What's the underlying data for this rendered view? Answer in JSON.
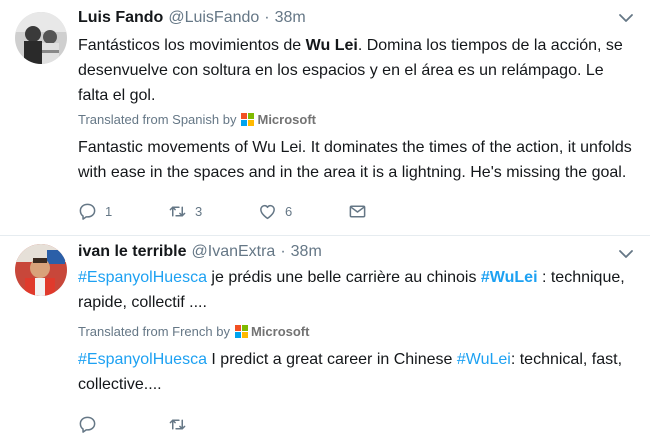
{
  "tweets": [
    {
      "name": "Luis Fando",
      "handle": "@LuisFando",
      "separator": "·",
      "time": "38m",
      "text": {
        "p1": "Fantásticos los movimientos de ",
        "b1": "Wu Lei",
        "p2": ". Domina los tiempos de la acción, se desenvuelve con soltura en los espacios y en el área es un relámpago. Le falta el gol."
      },
      "translated_from": "Translated from Spanish by",
      "translator": "Microsoft",
      "translation": "Fantastic movements of Wu Lei. It dominates the times of the action, it unfolds with ease in the spaces and in the area it is a lightning. He's missing the goal.",
      "replies": "1",
      "retweets": "3",
      "likes": "6"
    },
    {
      "name": "ivan le terrible",
      "handle": "@IvanExtra",
      "separator": "·",
      "time": "38m",
      "text": {
        "tag1": "#EspanyolHuesca",
        "p1": " je prédis une belle carrière au chinois ",
        "tag2": "#WuLei",
        "p2": " : technique, rapide, collectif ...."
      },
      "translated_from": "Translated from French by",
      "translator": "Microsoft",
      "translation": {
        "tag1": "#EspanyolHuesca",
        "p1": " I predict a great career in Chinese ",
        "tag2": "#WuLei",
        "p2": ": technical, fast, collective...."
      },
      "replies": "",
      "retweets": "",
      "likes": ""
    }
  ],
  "colors": {
    "link": "#1da1f2",
    "secondary": "#657786",
    "text": "#14171a",
    "ms_red": "#f25022",
    "ms_green": "#7fba00",
    "ms_blue": "#00a4ef",
    "ms_yellow": "#ffb900"
  },
  "icons": [
    "reply-icon",
    "retweet-icon",
    "like-icon",
    "message-icon",
    "chevron-down-icon"
  ]
}
